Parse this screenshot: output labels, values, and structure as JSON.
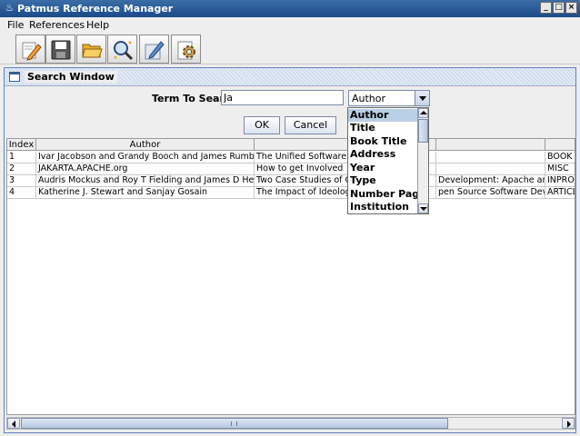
{
  "window": {
    "title": "Patmus Reference Manager",
    "app_icon": "java-coffee-icon",
    "controls": [
      "_",
      "□",
      "×"
    ]
  },
  "menu": [
    "File",
    "References",
    "Help"
  ],
  "toolbar": {
    "buttons": [
      {
        "icon": "edit-pencil-icon"
      },
      {
        "icon": "save-disk-icon"
      },
      {
        "icon": "open-folder-icon"
      },
      {
        "icon": "search-magnifier-icon"
      },
      {
        "icon": "edit-pen-icon"
      },
      {
        "icon": "settings-gear-icon"
      }
    ]
  },
  "search_window": {
    "title": "Search Window",
    "term_label": "Term To Search",
    "term_value": "Ja",
    "field_combo": {
      "selected": "Author",
      "options": [
        "Author",
        "Title",
        "Book Title",
        "Address",
        "Year",
        "Type",
        "Number Pages",
        "Institution"
      ]
    },
    "ok_label": "OK",
    "cancel_label": "Cancel"
  },
  "table": {
    "columns": [
      "Index",
      "Author",
      "",
      "",
      ""
    ],
    "rows": [
      [
        "1",
        "Ivar Jacobson and Grandy Booch and James Rumb...",
        "The Unified Software De",
        "",
        "BOOK"
      ],
      [
        "2",
        "JAKARTA.APACHE.org",
        "How to get Involved",
        "",
        "MISC"
      ],
      [
        "3",
        "Audris Mockus and Roy T Fielding and James D Her...",
        "Two Case Studies of O",
        "Development: Apache and...",
        "INPRO"
      ],
      [
        "4",
        "Katherine J. Stewart and Sanjay Gosain",
        "The Impact of Ideology",
        "pen Source Software Devel...",
        "ARTICL"
      ]
    ]
  },
  "colors": {
    "titlebar": "#1c4a8a",
    "frame_border": "#6382bf",
    "selection": "#b8cfe5"
  }
}
